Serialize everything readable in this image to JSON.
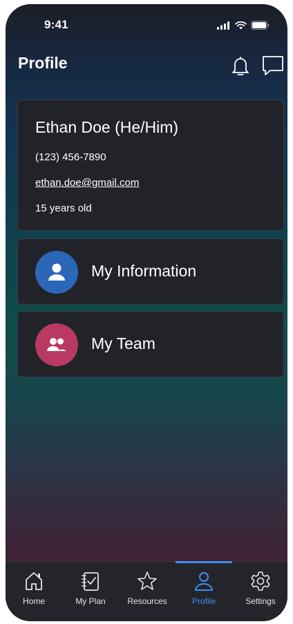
{
  "status_bar": {
    "time": "9:41"
  },
  "header": {
    "title": "Profile"
  },
  "user": {
    "name": "Ethan Doe (He/Him)",
    "phone": "(123) 456-7890",
    "email": "ethan.doe@gmail.com",
    "age": "15 years old"
  },
  "menu": [
    {
      "label": "My Information",
      "icon": "person-icon",
      "color": "#2c66b8"
    },
    {
      "label": "My Team",
      "icon": "team-icon",
      "color": "#b83a62"
    }
  ],
  "tabs": [
    {
      "label": "Home",
      "icon": "home-icon",
      "active": false
    },
    {
      "label": "My Plan",
      "icon": "plan-icon",
      "active": false
    },
    {
      "label": "Resources",
      "icon": "star-icon",
      "active": false
    },
    {
      "label": "Profile",
      "icon": "profile-icon",
      "active": true
    },
    {
      "label": "Settings",
      "icon": "gear-icon",
      "active": false
    }
  ],
  "colors": {
    "active_tab": "#3f8ef0",
    "card_bg": "#222329"
  }
}
